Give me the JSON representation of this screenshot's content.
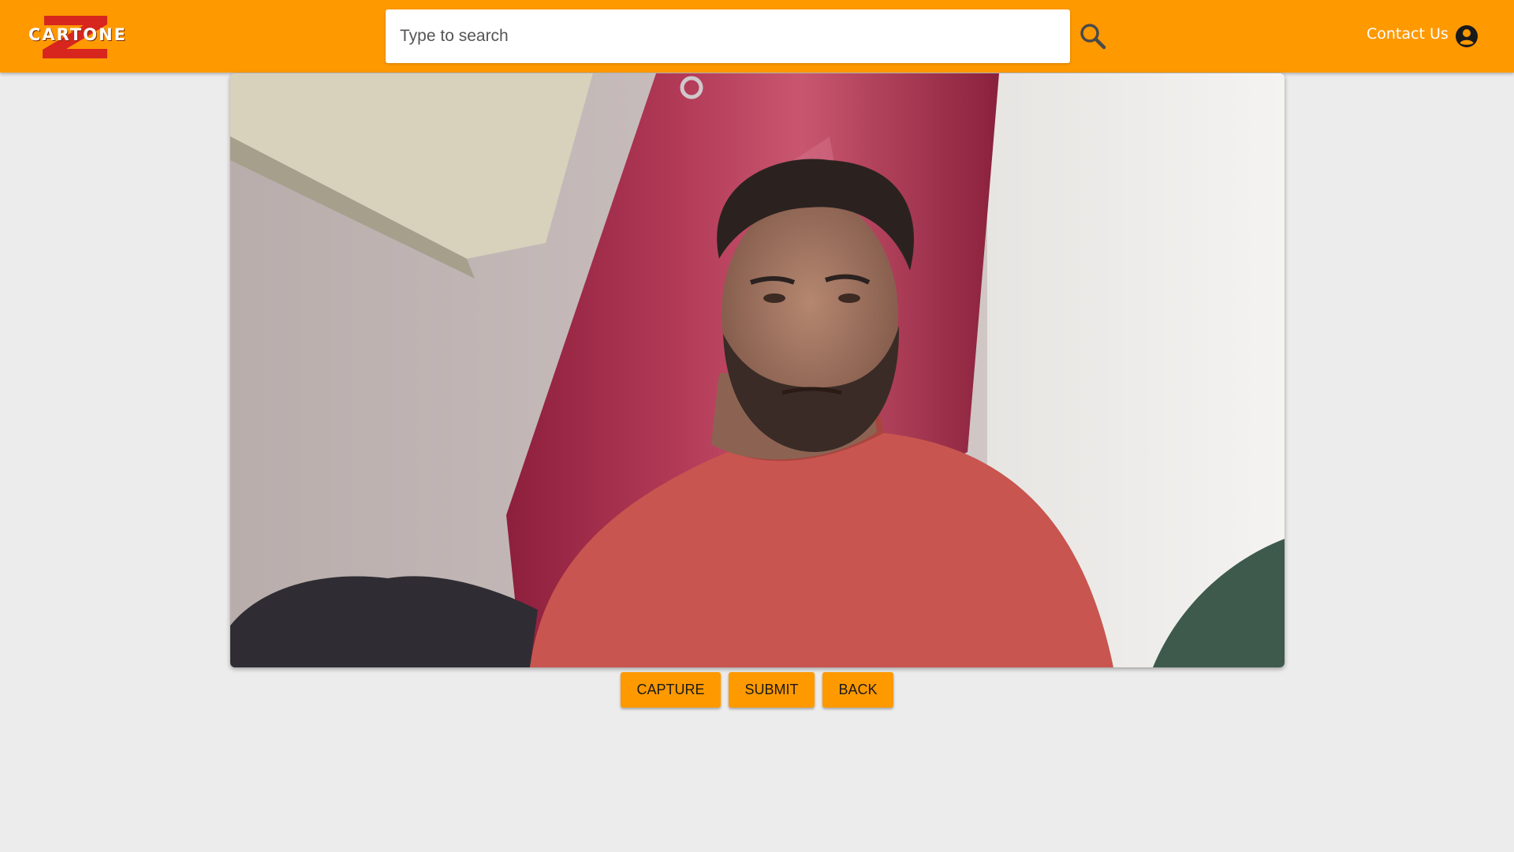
{
  "header": {
    "logo_text": "CARTONE",
    "logo_icon": "cartonez-logo",
    "search_placeholder": "Type to search",
    "search_icon": "search-icon",
    "contact_label": "Contact Us",
    "account_icon": "account-circle-icon"
  },
  "camera": {
    "preview": "webcam-preview"
  },
  "actions": {
    "capture_label": "CAPTURE",
    "submit_label": "SUBMIT",
    "back_label": "BACK"
  },
  "colors": {
    "accent": "#ff9900",
    "background": "#ececec",
    "logo_red": "#d7261e"
  }
}
